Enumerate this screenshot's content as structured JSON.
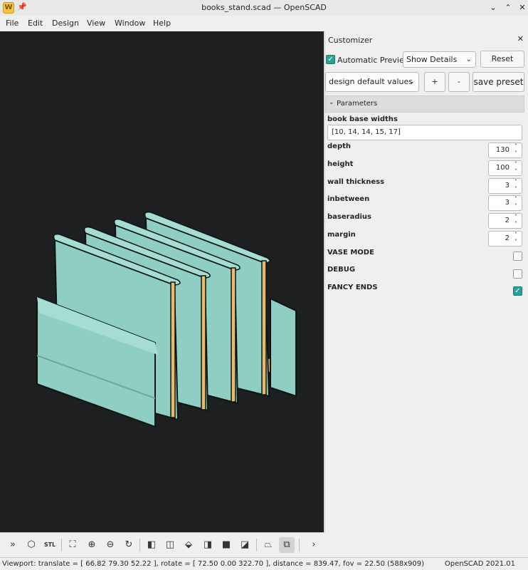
{
  "window": {
    "title": "books_stand.scad — OpenSCAD"
  },
  "menu": [
    "File",
    "Edit",
    "Design",
    "View",
    "Window",
    "Help"
  ],
  "customizer": {
    "title": "Customizer",
    "automatic_preview_label": "Automatic Preview",
    "automatic_preview_checked": true,
    "details_mode": "Show Details",
    "reset_label": "Reset",
    "preset": "design default values",
    "add_preset_label": "+",
    "remove_preset_label": "-",
    "save_preset_label": "save preset",
    "section_title": "Parameters",
    "params": {
      "book_base_widths": {
        "label": "book base widths",
        "value": "[10, 14, 14, 15, 17]"
      },
      "depth": {
        "label": "depth",
        "value": "130"
      },
      "height": {
        "label": "height",
        "value": "100"
      },
      "wall_thickness": {
        "label": "wall thickness",
        "value": "3"
      },
      "inbetween": {
        "label": "inbetween",
        "value": "3"
      },
      "baseradius": {
        "label": "baseradius",
        "value": "2"
      },
      "margin": {
        "label": "margin",
        "value": "2"
      },
      "vase_mode": {
        "label": "VASE MODE",
        "checked": false
      },
      "debug": {
        "label": "DEBUG",
        "checked": false
      },
      "fancy_ends": {
        "label": "FANCY ENDS",
        "checked": true
      }
    }
  },
  "toolbar": {
    "buttons": [
      "preview-icon",
      "render-icon",
      "export-stl-icon",
      "view-all-icon",
      "zoom-in-icon",
      "zoom-out-icon",
      "reset-view-icon",
      "view-right-icon",
      "view-top-icon",
      "view-bottom-icon",
      "view-left-icon",
      "view-front-icon",
      "view-back-icon",
      "perspective-icon",
      "orthogonal-icon",
      "more-icon"
    ],
    "stl_label": "STL"
  },
  "status": {
    "viewport": "Viewport: translate = [ 66.82 79.30 52.22 ], rotate = [ 72.50 0.00 322.70 ], distance = 839.47, fov = 22.50 (588x909)",
    "version": "OpenSCAD 2021.01"
  },
  "colors": {
    "model": "#8fcfc3",
    "model_dark": "#6fa79d",
    "edge": "#0b1513",
    "base": "#e9b86a",
    "background": "#1d1f21",
    "accent": "#2aa198"
  }
}
